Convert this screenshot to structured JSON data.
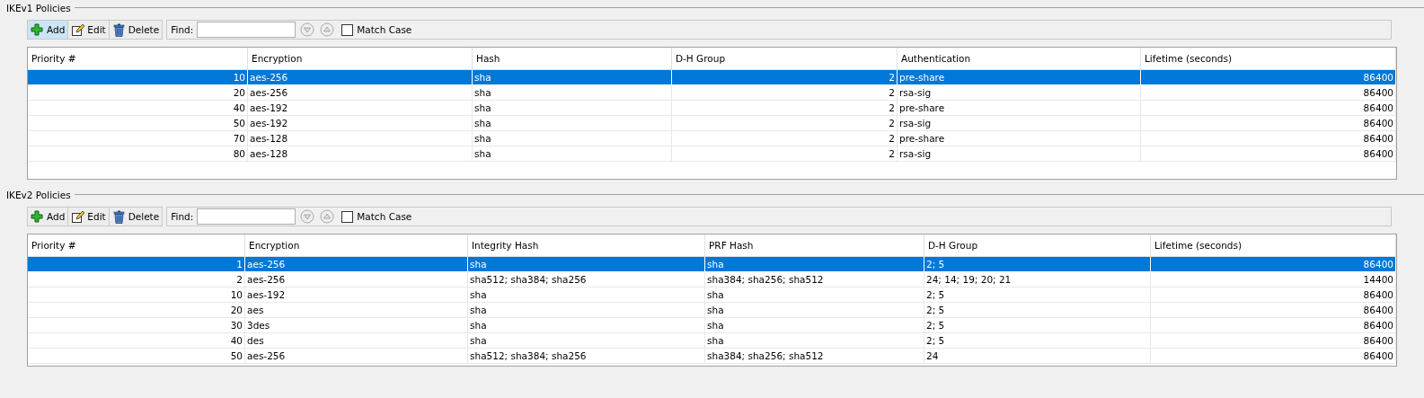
{
  "sections": [
    {
      "title": "IKEv1 Policies",
      "toolbar": {
        "buttons": [
          {
            "kind": "add",
            "label": "Add",
            "highlighted": true
          },
          {
            "kind": "edit",
            "label": "Edit",
            "highlighted": false
          },
          {
            "kind": "delete",
            "label": "Delete",
            "highlighted": false
          }
        ],
        "find_label": "Find:",
        "match_case": {
          "label": "Match Case",
          "checked": false
        }
      },
      "table": {
        "columns": [
          {
            "label": "Priority #",
            "kind": "number"
          },
          {
            "label": "Encryption",
            "kind": "text"
          },
          {
            "label": "Hash",
            "kind": "text"
          },
          {
            "label": "D-H Group",
            "kind": "number"
          },
          {
            "label": "Authentication",
            "kind": "text"
          },
          {
            "label": "Lifetime (seconds)",
            "kind": "number"
          }
        ],
        "rows": [
          {
            "selected": true,
            "cells": [
              "10",
              "aes-256",
              "sha",
              "2",
              "pre-share",
              "86400"
            ]
          },
          {
            "selected": false,
            "cells": [
              "20",
              "aes-256",
              "sha",
              "2",
              "rsa-sig",
              "86400"
            ]
          },
          {
            "selected": false,
            "cells": [
              "40",
              "aes-192",
              "sha",
              "2",
              "pre-share",
              "86400"
            ]
          },
          {
            "selected": false,
            "cells": [
              "50",
              "aes-192",
              "sha",
              "2",
              "rsa-sig",
              "86400"
            ]
          },
          {
            "selected": false,
            "cells": [
              "70",
              "aes-128",
              "sha",
              "2",
              "pre-share",
              "86400"
            ]
          },
          {
            "selected": false,
            "cells": [
              "80",
              "aes-128",
              "sha",
              "2",
              "rsa-sig",
              "86400"
            ]
          }
        ]
      }
    },
    {
      "title": "IKEv2 Policies",
      "toolbar": {
        "buttons": [
          {
            "kind": "add",
            "label": "Add",
            "highlighted": false
          },
          {
            "kind": "edit",
            "label": "Edit",
            "highlighted": false
          },
          {
            "kind": "delete",
            "label": "Delete",
            "highlighted": false
          }
        ],
        "find_label": "Find:",
        "match_case": {
          "label": "Match Case",
          "checked": false
        }
      },
      "table": {
        "columns": [
          {
            "label": "Priority #",
            "kind": "number"
          },
          {
            "label": "Encryption",
            "kind": "text"
          },
          {
            "label": "Integrity Hash",
            "kind": "text"
          },
          {
            "label": "PRF Hash",
            "kind": "text"
          },
          {
            "label": "D-H Group",
            "kind": "text"
          },
          {
            "label": "Lifetime (seconds)",
            "kind": "number"
          }
        ],
        "rows": [
          {
            "selected": true,
            "cells": [
              "1",
              "aes-256",
              "sha",
              "sha",
              "2; 5",
              "86400"
            ]
          },
          {
            "selected": false,
            "cells": [
              "2",
              "aes-256",
              "sha512; sha384; sha256",
              "sha384; sha256; sha512",
              "24; 14; 19; 20; 21",
              "14400"
            ]
          },
          {
            "selected": false,
            "cells": [
              "10",
              "aes-192",
              "sha",
              "sha",
              "2; 5",
              "86400"
            ]
          },
          {
            "selected": false,
            "cells": [
              "20",
              "aes",
              "sha",
              "sha",
              "2; 5",
              "86400"
            ]
          },
          {
            "selected": false,
            "cells": [
              "30",
              "3des",
              "sha",
              "sha",
              "2; 5",
              "86400"
            ]
          },
          {
            "selected": false,
            "cells": [
              "40",
              "des",
              "sha",
              "sha",
              "2; 5",
              "86400"
            ]
          },
          {
            "selected": false,
            "cells": [
              "50",
              "aes-256",
              "sha512; sha384; sha256",
              "sha384; sha256; sha512",
              "24",
              "86400"
            ]
          }
        ]
      }
    }
  ]
}
